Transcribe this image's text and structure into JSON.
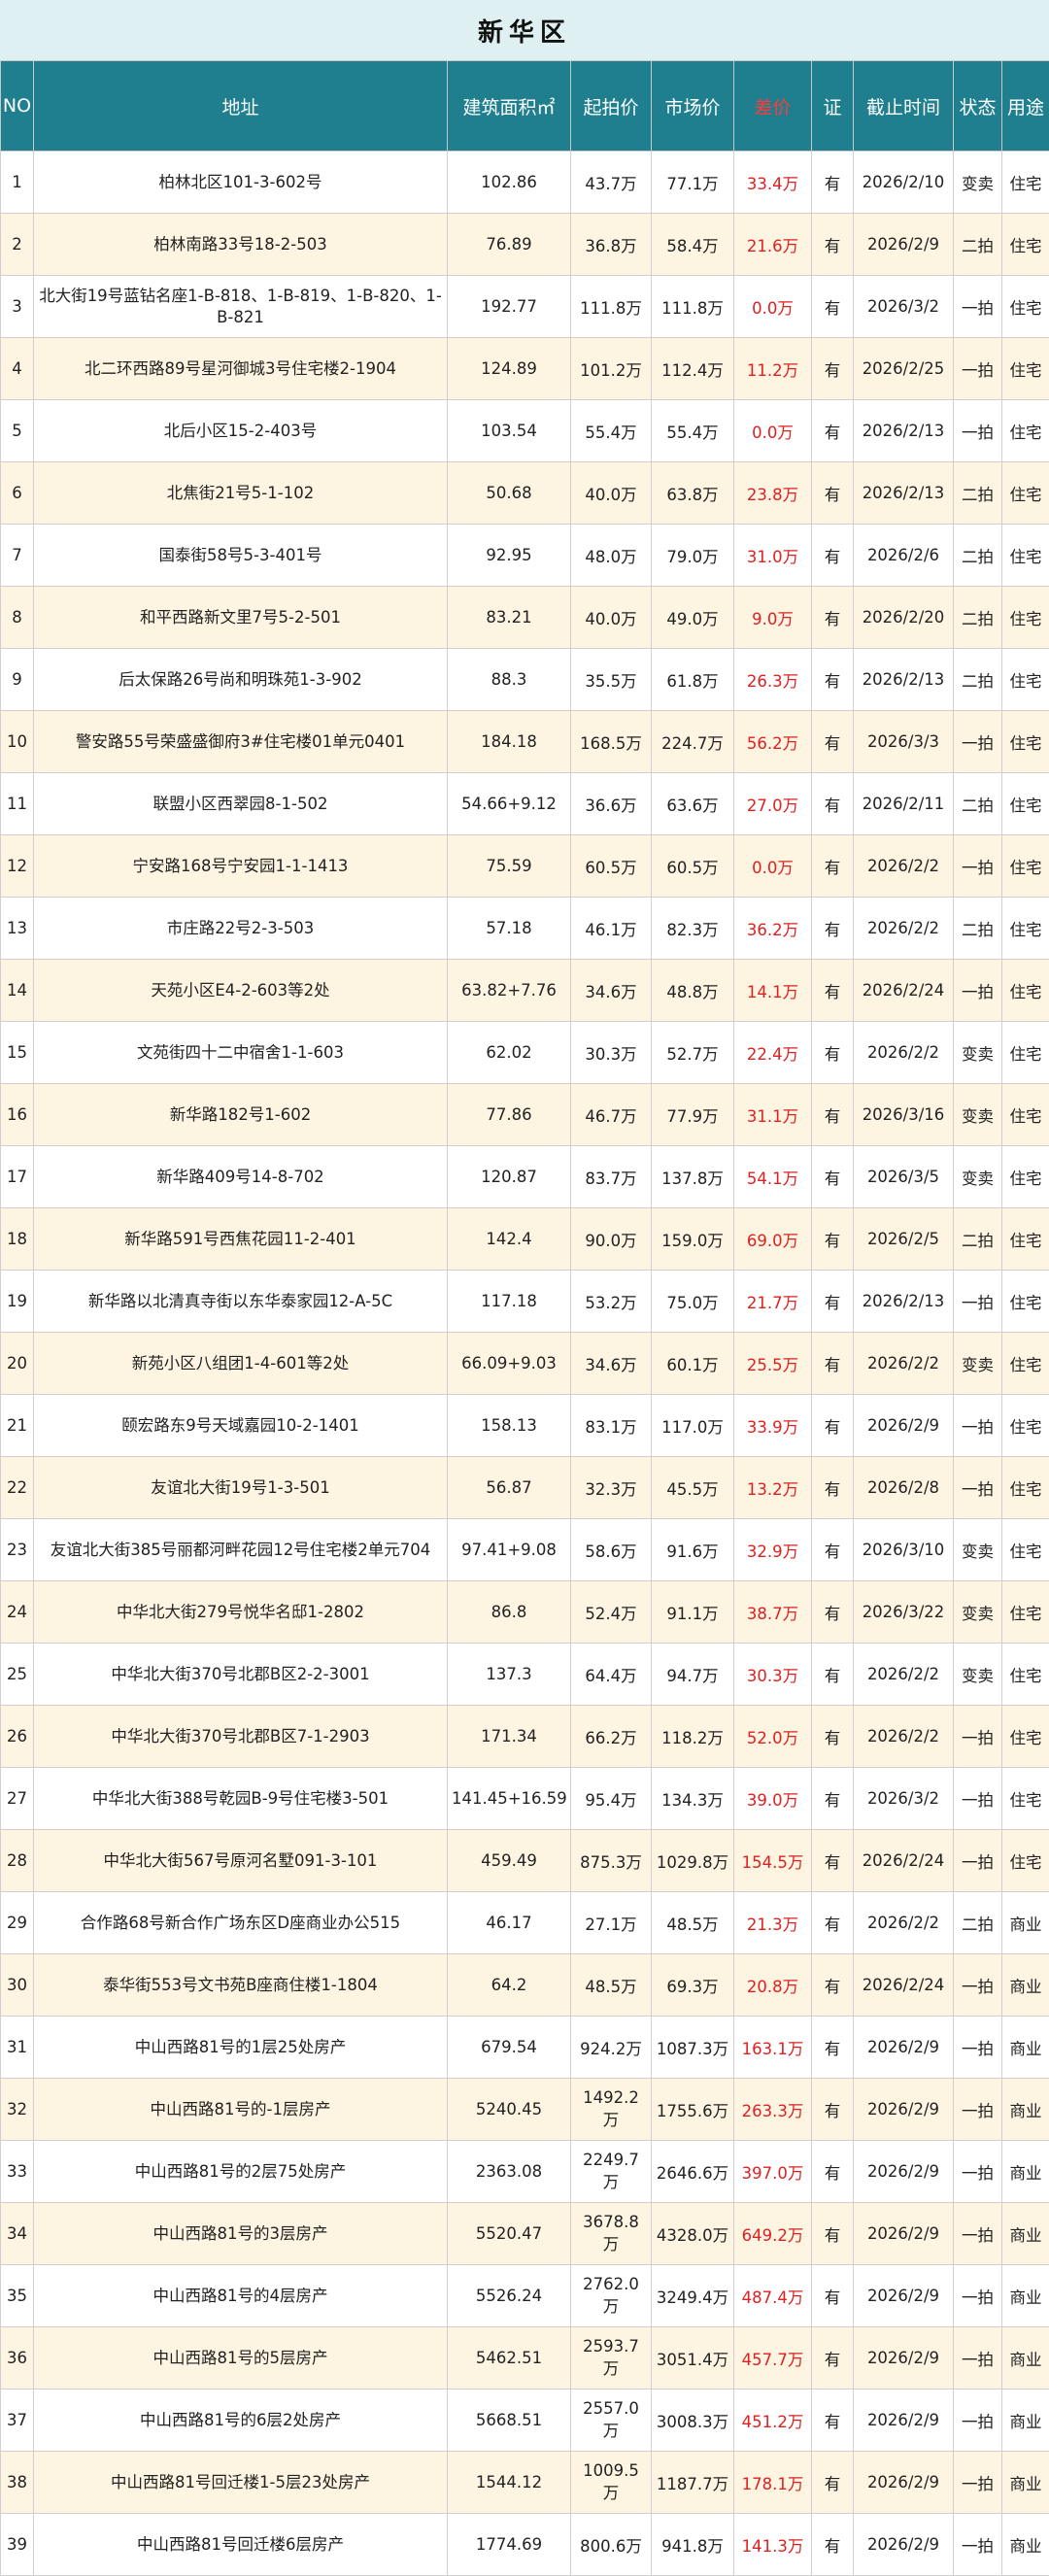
{
  "title": "新华区",
  "headers": [
    "NO",
    "地址",
    "建筑面积㎡",
    "起拍价",
    "市场价",
    "差价",
    "证",
    "截止时间",
    "状态",
    "用途"
  ],
  "rows": [
    {
      "no": "1",
      "address": "柏林北区101-3-602号",
      "area": "102.86",
      "start": "43.7万",
      "market": "77.1万",
      "diff": "33.4万",
      "cert": "有",
      "deadline": "2026/2/10",
      "status": "变卖",
      "use": "住宅"
    },
    {
      "no": "2",
      "address": "柏林南路33号18-2-503",
      "area": "76.89",
      "start": "36.8万",
      "market": "58.4万",
      "diff": "21.6万",
      "cert": "有",
      "deadline": "2026/2/9",
      "status": "二拍",
      "use": "住宅"
    },
    {
      "no": "3",
      "address": "北大街19号蓝钻名座1-B-818、1-B-819、1-B-820、1-B-821",
      "area": "192.77",
      "start": "111.8万",
      "market": "111.8万",
      "diff": "0.0万",
      "cert": "有",
      "deadline": "2026/3/2",
      "status": "一拍",
      "use": "住宅"
    },
    {
      "no": "4",
      "address": "北二环西路89号星河御城3号住宅楼2-1904",
      "area": "124.89",
      "start": "101.2万",
      "market": "112.4万",
      "diff": "11.2万",
      "cert": "有",
      "deadline": "2026/2/25",
      "status": "一拍",
      "use": "住宅"
    },
    {
      "no": "5",
      "address": "北后小区15-2-403号",
      "area": "103.54",
      "start": "55.4万",
      "market": "55.4万",
      "diff": "0.0万",
      "cert": "有",
      "deadline": "2026/2/13",
      "status": "一拍",
      "use": "住宅"
    },
    {
      "no": "6",
      "address": "北焦街21号5-1-102",
      "area": "50.68",
      "start": "40.0万",
      "market": "63.8万",
      "diff": "23.8万",
      "cert": "有",
      "deadline": "2026/2/13",
      "status": "二拍",
      "use": "住宅"
    },
    {
      "no": "7",
      "address": "国泰街58号5-3-401号",
      "area": "92.95",
      "start": "48.0万",
      "market": "79.0万",
      "diff": "31.0万",
      "cert": "有",
      "deadline": "2026/2/6",
      "status": "二拍",
      "use": "住宅"
    },
    {
      "no": "8",
      "address": "和平西路新文里7号5-2-501",
      "area": "83.21",
      "start": "40.0万",
      "market": "49.0万",
      "diff": "9.0万",
      "cert": "有",
      "deadline": "2026/2/20",
      "status": "二拍",
      "use": "住宅"
    },
    {
      "no": "9",
      "address": "后太保路26号尚和明珠苑1-3-902",
      "area": "88.3",
      "start": "35.5万",
      "market": "61.8万",
      "diff": "26.3万",
      "cert": "有",
      "deadline": "2026/2/13",
      "status": "二拍",
      "use": "住宅"
    },
    {
      "no": "10",
      "address": "警安路55号荣盛盛御府3#住宅楼01单元0401",
      "area": "184.18",
      "start": "168.5万",
      "market": "224.7万",
      "diff": "56.2万",
      "cert": "有",
      "deadline": "2026/3/3",
      "status": "一拍",
      "use": "住宅"
    },
    {
      "no": "11",
      "address": "联盟小区西翠园8-1-502",
      "area": "54.66+9.12",
      "start": "36.6万",
      "market": "63.6万",
      "diff": "27.0万",
      "cert": "有",
      "deadline": "2026/2/11",
      "status": "二拍",
      "use": "住宅"
    },
    {
      "no": "12",
      "address": "宁安路168号宁安园1-1-1413",
      "area": "75.59",
      "start": "60.5万",
      "market": "60.5万",
      "diff": "0.0万",
      "cert": "有",
      "deadline": "2026/2/2",
      "status": "一拍",
      "use": "住宅"
    },
    {
      "no": "13",
      "address": "市庄路22号2-3-503",
      "area": "57.18",
      "start": "46.1万",
      "market": "82.3万",
      "diff": "36.2万",
      "cert": "有",
      "deadline": "2026/2/2",
      "status": "二拍",
      "use": "住宅"
    },
    {
      "no": "14",
      "address": "天苑小区E4-2-603等2处",
      "area": "63.82+7.76",
      "start": "34.6万",
      "market": "48.8万",
      "diff": "14.1万",
      "cert": "有",
      "deadline": "2026/2/24",
      "status": "一拍",
      "use": "住宅"
    },
    {
      "no": "15",
      "address": "文苑街四十二中宿舍1-1-603",
      "area": "62.02",
      "start": "30.3万",
      "market": "52.7万",
      "diff": "22.4万",
      "cert": "有",
      "deadline": "2026/2/2",
      "status": "变卖",
      "use": "住宅"
    },
    {
      "no": "16",
      "address": "新华路182号1-602",
      "area": "77.86",
      "start": "46.7万",
      "market": "77.9万",
      "diff": "31.1万",
      "cert": "有",
      "deadline": "2026/3/16",
      "status": "变卖",
      "use": "住宅"
    },
    {
      "no": "17",
      "address": "新华路409号14-8-702",
      "area": "120.87",
      "start": "83.7万",
      "market": "137.8万",
      "diff": "54.1万",
      "cert": "有",
      "deadline": "2026/3/5",
      "status": "变卖",
      "use": "住宅"
    },
    {
      "no": "18",
      "address": "新华路591号西焦花园11-2-401",
      "area": "142.4",
      "start": "90.0万",
      "market": "159.0万",
      "diff": "69.0万",
      "cert": "有",
      "deadline": "2026/2/5",
      "status": "二拍",
      "use": "住宅"
    },
    {
      "no": "19",
      "address": "新华路以北清真寺街以东华泰家园12-A-5C",
      "area": "117.18",
      "start": "53.2万",
      "market": "75.0万",
      "diff": "21.7万",
      "cert": "有",
      "deadline": "2026/2/13",
      "status": "一拍",
      "use": "住宅"
    },
    {
      "no": "20",
      "address": "新苑小区八组团1-4-601等2处",
      "area": "66.09+9.03",
      "start": "34.6万",
      "market": "60.1万",
      "diff": "25.5万",
      "cert": "有",
      "deadline": "2026/2/2",
      "status": "变卖",
      "use": "住宅"
    },
    {
      "no": "21",
      "address": "颐宏路东9号天域嘉园10-2-1401",
      "area": "158.13",
      "start": "83.1万",
      "market": "117.0万",
      "diff": "33.9万",
      "cert": "有",
      "deadline": "2026/2/9",
      "status": "一拍",
      "use": "住宅"
    },
    {
      "no": "22",
      "address": "友谊北大街19号1-3-501",
      "area": "56.87",
      "start": "32.3万",
      "market": "45.5万",
      "diff": "13.2万",
      "cert": "有",
      "deadline": "2026/2/8",
      "status": "一拍",
      "use": "住宅"
    },
    {
      "no": "23",
      "address": "友谊北大街385号丽都河畔花园12号住宅楼2单元704",
      "area": "97.41+9.08",
      "start": "58.6万",
      "market": "91.6万",
      "diff": "32.9万",
      "cert": "有",
      "deadline": "2026/3/10",
      "status": "变卖",
      "use": "住宅"
    },
    {
      "no": "24",
      "address": "中华北大街279号悦华名邸1-2802",
      "area": "86.8",
      "start": "52.4万",
      "market": "91.1万",
      "diff": "38.7万",
      "cert": "有",
      "deadline": "2026/3/22",
      "status": "变卖",
      "use": "住宅"
    },
    {
      "no": "25",
      "address": "中华北大街370号北郡B区2-2-3001",
      "area": "137.3",
      "start": "64.4万",
      "market": "94.7万",
      "diff": "30.3万",
      "cert": "有",
      "deadline": "2026/2/2",
      "status": "变卖",
      "use": "住宅"
    },
    {
      "no": "26",
      "address": "中华北大街370号北郡B区7-1-2903",
      "area": "171.34",
      "start": "66.2万",
      "market": "118.2万",
      "diff": "52.0万",
      "cert": "有",
      "deadline": "2026/2/2",
      "status": "一拍",
      "use": "住宅"
    },
    {
      "no": "27",
      "address": "中华北大街388号乾园B-9号住宅楼3-501",
      "area": "141.45+16.59",
      "start": "95.4万",
      "market": "134.3万",
      "diff": "39.0万",
      "cert": "有",
      "deadline": "2026/3/2",
      "status": "一拍",
      "use": "住宅"
    },
    {
      "no": "28",
      "address": "中华北大街567号原河名墅091-3-101",
      "area": "459.49",
      "start": "875.3万",
      "market": "1029.8万",
      "diff": "154.5万",
      "cert": "有",
      "deadline": "2026/2/24",
      "status": "一拍",
      "use": "住宅"
    },
    {
      "no": "29",
      "address": "合作路68号新合作广场东区D座商业办公515",
      "area": "46.17",
      "start": "27.1万",
      "market": "48.5万",
      "diff": "21.3万",
      "cert": "有",
      "deadline": "2026/2/2",
      "status": "二拍",
      "use": "商业"
    },
    {
      "no": "30",
      "address": "泰华街553号文书苑B座商住楼1-1804",
      "area": "64.2",
      "start": "48.5万",
      "market": "69.3万",
      "diff": "20.8万",
      "cert": "有",
      "deadline": "2026/2/24",
      "status": "一拍",
      "use": "商业"
    },
    {
      "no": "31",
      "address": "中山西路81号的1层25处房产",
      "area": "679.54",
      "start": "924.2万",
      "market": "1087.3万",
      "diff": "163.1万",
      "cert": "有",
      "deadline": "2026/2/9",
      "status": "一拍",
      "use": "商业"
    },
    {
      "no": "32",
      "address": "中山西路81号的-1层房产",
      "area": "5240.45",
      "start": "1492.2万",
      "market": "1755.6万",
      "diff": "263.3万",
      "cert": "有",
      "deadline": "2026/2/9",
      "status": "一拍",
      "use": "商业"
    },
    {
      "no": "33",
      "address": "中山西路81号的2层75处房产",
      "area": "2363.08",
      "start": "2249.7万",
      "market": "2646.6万",
      "diff": "397.0万",
      "cert": "有",
      "deadline": "2026/2/9",
      "status": "一拍",
      "use": "商业"
    },
    {
      "no": "34",
      "address": "中山西路81号的3层房产",
      "area": "5520.47",
      "start": "3678.8万",
      "market": "4328.0万",
      "diff": "649.2万",
      "cert": "有",
      "deadline": "2026/2/9",
      "status": "一拍",
      "use": "商业"
    },
    {
      "no": "35",
      "address": "中山西路81号的4层房产",
      "area": "5526.24",
      "start": "2762.0万",
      "market": "3249.4万",
      "diff": "487.4万",
      "cert": "有",
      "deadline": "2026/2/9",
      "status": "一拍",
      "use": "商业"
    },
    {
      "no": "36",
      "address": "中山西路81号的5层房产",
      "area": "5462.51",
      "start": "2593.7万",
      "market": "3051.4万",
      "diff": "457.7万",
      "cert": "有",
      "deadline": "2026/2/9",
      "status": "一拍",
      "use": "商业"
    },
    {
      "no": "37",
      "address": "中山西路81号的6层2处房产",
      "area": "5668.51",
      "start": "2557.0万",
      "market": "3008.3万",
      "diff": "451.2万",
      "cert": "有",
      "deadline": "2026/2/9",
      "status": "一拍",
      "use": "商业"
    },
    {
      "no": "38",
      "address": "中山西路81号回迁楼1-5层23处房产",
      "area": "1544.12",
      "start": "1009.5万",
      "market": "1187.7万",
      "diff": "178.1万",
      "cert": "有",
      "deadline": "2026/2/9",
      "status": "一拍",
      "use": "商业"
    },
    {
      "no": "39",
      "address": "中山西路81号回迁楼6层房产",
      "area": "1774.69",
      "start": "800.6万",
      "market": "941.8万",
      "diff": "141.3万",
      "cert": "有",
      "deadline": "2026/2/9",
      "status": "一拍",
      "use": "商业"
    }
  ]
}
